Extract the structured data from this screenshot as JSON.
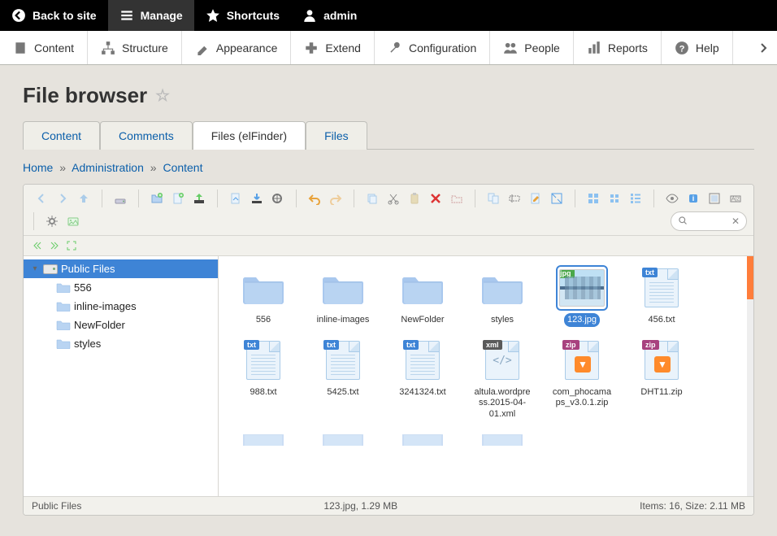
{
  "topbar": {
    "back": "Back to site",
    "manage": "Manage",
    "shortcuts": "Shortcuts",
    "admin": "admin"
  },
  "admin_tabs": {
    "content": "Content",
    "structure": "Structure",
    "appearance": "Appearance",
    "extend": "Extend",
    "configuration": "Configuration",
    "people": "People",
    "reports": "Reports",
    "help": "Help"
  },
  "page_title": "File browser",
  "sec_tabs": {
    "content": "Content",
    "comments": "Comments",
    "files_elfinder": "Files (elFinder)",
    "files": "Files"
  },
  "breadcrumb": {
    "home": "Home",
    "administration": "Administration",
    "content": "Content"
  },
  "search_placeholder": "",
  "tree": {
    "root": "Public Files",
    "items": [
      "556",
      "inline-images",
      "NewFolder",
      "styles"
    ]
  },
  "files": [
    {
      "name": "556",
      "type": "folder"
    },
    {
      "name": "inline-images",
      "type": "folder"
    },
    {
      "name": "NewFolder",
      "type": "folder"
    },
    {
      "name": "styles",
      "type": "folder"
    },
    {
      "name": "123.jpg",
      "type": "image",
      "selected": true,
      "badge": "jpg"
    },
    {
      "name": "456.txt",
      "type": "doc",
      "badge": "txt"
    },
    {
      "name": "988.txt",
      "type": "doc",
      "badge": "txt"
    },
    {
      "name": "5425.txt",
      "type": "doc",
      "badge": "txt"
    },
    {
      "name": "3241324.txt",
      "type": "doc",
      "badge": "txt"
    },
    {
      "name": "altula.wordpress.2015-04-01.xml",
      "type": "xml",
      "badge": "xml"
    },
    {
      "name": "com_phocamaps_v3.0.1.zip",
      "type": "zip",
      "badge": "zip"
    },
    {
      "name": "DHT11.zip",
      "type": "zip",
      "badge": "zip"
    }
  ],
  "status": {
    "path": "Public Files",
    "selection": "123.jpg, 1.29 MB",
    "summary": "Items: 16, Size: 2.11 MB"
  }
}
